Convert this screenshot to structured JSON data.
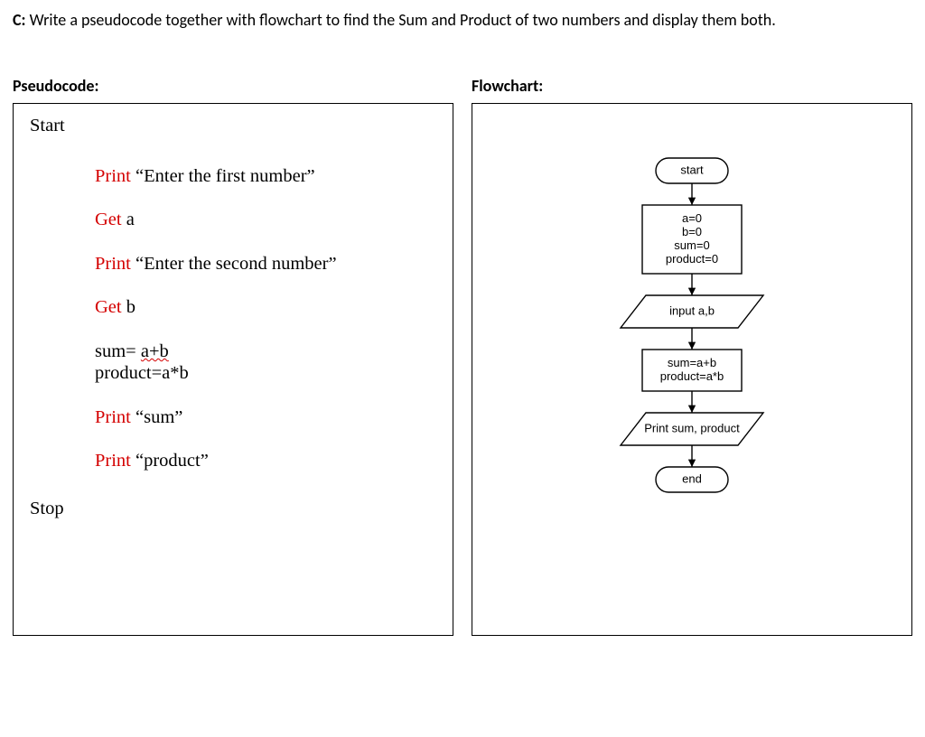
{
  "question": {
    "label": "C:",
    "text": "Write a pseudocode together with flowchart to find the Sum and Product of two numbers and display them both."
  },
  "left": {
    "heading": "Pseudocode:",
    "start": "Start",
    "stop": "Stop",
    "kw_print": "Print",
    "kw_get": "Get",
    "txt_enter_first": " “Enter the first number”",
    "txt_a": " a",
    "txt_enter_second": " “Enter the second number”",
    "txt_b": " b",
    "txt_sum_eq": "sum= ",
    "txt_aplusb": "a+b",
    "txt_product_eq": "product=a*b",
    "txt_sum_q": " “sum”",
    "txt_product_q": " “product”"
  },
  "right": {
    "heading": "Flowchart:"
  },
  "chart_data": {
    "type": "flowchart",
    "nodes": [
      {
        "id": "start",
        "shape": "terminator",
        "text": "start"
      },
      {
        "id": "init",
        "shape": "process",
        "text": [
          "a=0",
          "b=0",
          "sum=0",
          "product=0"
        ]
      },
      {
        "id": "input",
        "shape": "io",
        "text": "input a,b"
      },
      {
        "id": "calc",
        "shape": "process",
        "text": [
          "sum=a+b",
          "product=a*b"
        ]
      },
      {
        "id": "output",
        "shape": "io",
        "text": "Print sum, product"
      },
      {
        "id": "end",
        "shape": "terminator",
        "text": "end"
      }
    ],
    "edges": [
      [
        "start",
        "init"
      ],
      [
        "init",
        "input"
      ],
      [
        "input",
        "calc"
      ],
      [
        "calc",
        "output"
      ],
      [
        "output",
        "end"
      ]
    ]
  }
}
